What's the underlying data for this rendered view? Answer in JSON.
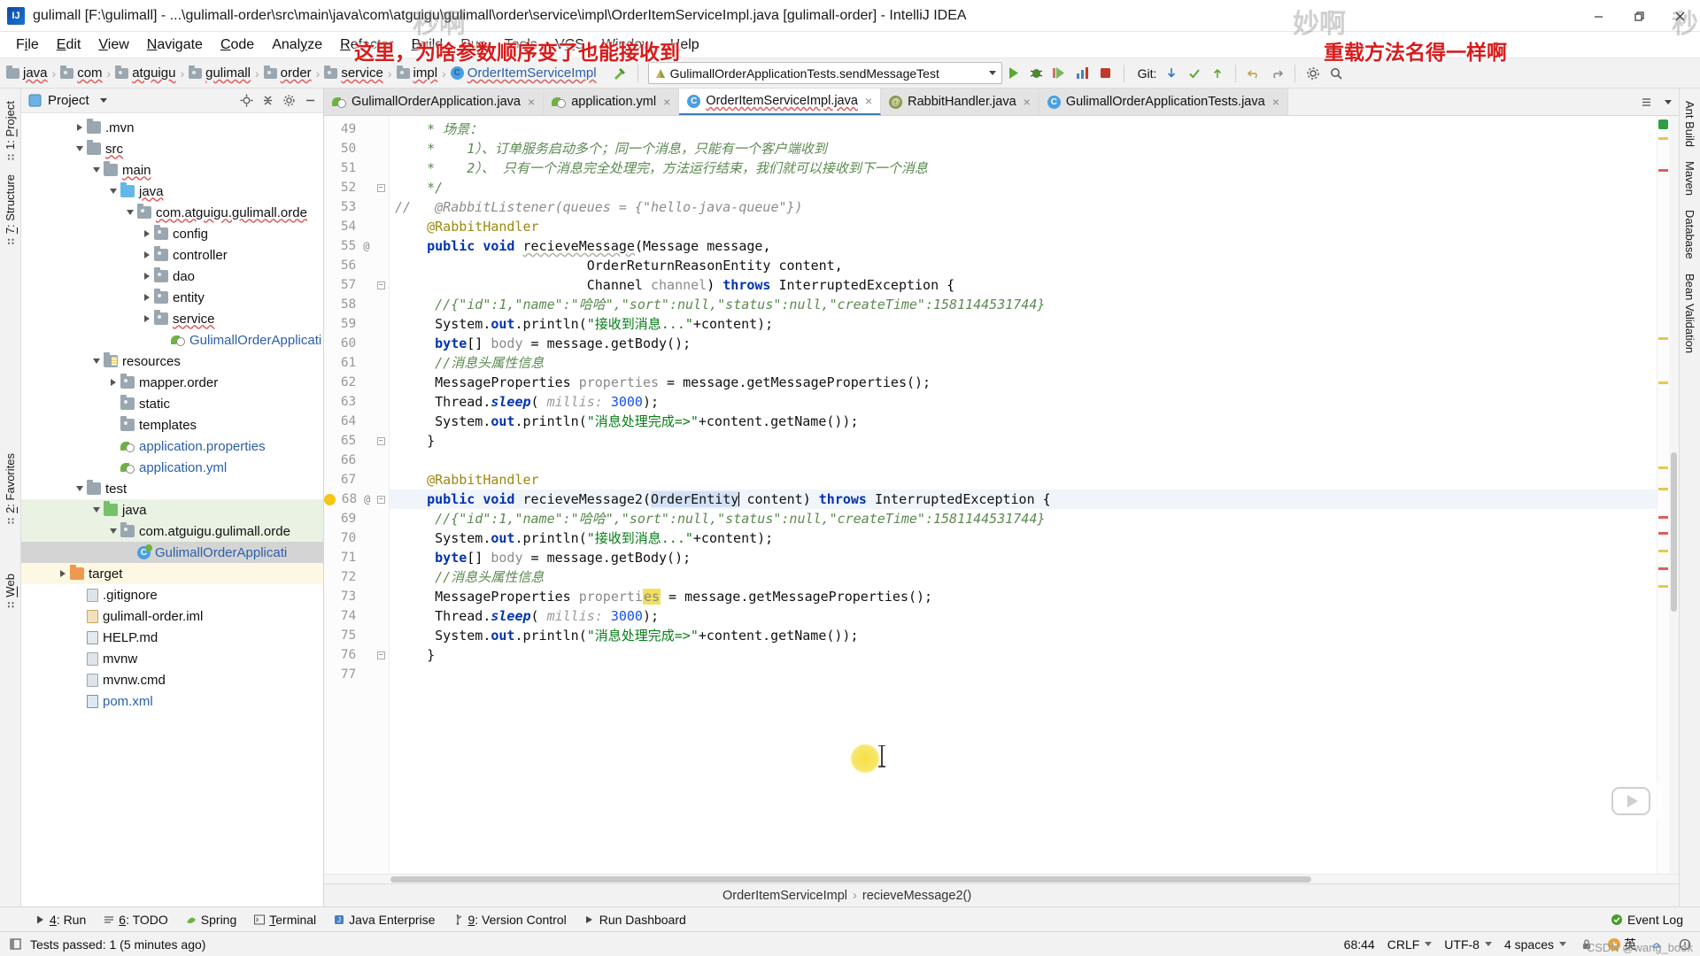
{
  "window": {
    "title": "gulimall [F:\\gulimall] - ...\\gulimall-order\\src\\main\\java\\com\\atguigu\\gulimall\\order\\service\\impl\\OrderItemServiceImpl.java [gulimall-order] - IntelliJ IDEA",
    "logo_text": "IJ",
    "minimize_label": "minimize-icon",
    "maximize_label": "restore-icon",
    "close_label": "close-icon"
  },
  "menubar": [
    {
      "pre": "F",
      "mn": "i",
      "post": "le"
    },
    {
      "pre": "",
      "mn": "E",
      "post": "dit"
    },
    {
      "pre": "",
      "mn": "V",
      "post": "iew"
    },
    {
      "pre": "",
      "mn": "N",
      "post": "avigate"
    },
    {
      "pre": "",
      "mn": "C",
      "post": "ode"
    },
    {
      "pre": "Anal",
      "mn": "y",
      "post": "ze"
    },
    {
      "pre": "",
      "mn": "R",
      "post": "efactor"
    },
    {
      "pre": "",
      "mn": "B",
      "post": "uild"
    },
    {
      "pre": "R",
      "mn": "u",
      "post": "n"
    },
    {
      "pre": "",
      "mn": "T",
      "post": "ools"
    },
    {
      "pre": "V",
      "mn": "C",
      "post": "S"
    },
    {
      "pre": "",
      "mn": "W",
      "post": "indow"
    },
    {
      "pre": "",
      "mn": "H",
      "post": "elp"
    }
  ],
  "breadcrumb": {
    "items": [
      {
        "label": "java",
        "icon": "folder-icon",
        "type": "folder"
      },
      {
        "label": "com",
        "icon": "package-icon",
        "type": "package"
      },
      {
        "label": "atguigu",
        "icon": "package-icon",
        "type": "package"
      },
      {
        "label": "gulimall",
        "icon": "package-icon",
        "type": "package"
      },
      {
        "label": "order",
        "icon": "package-icon",
        "type": "package"
      },
      {
        "label": "service",
        "icon": "package-icon",
        "type": "package"
      },
      {
        "label": "impl",
        "icon": "package-icon",
        "type": "package"
      },
      {
        "label": "OrderItemServiceImpl",
        "icon": "class-icon",
        "type": "class"
      }
    ],
    "separator": "›"
  },
  "toolbar": {
    "run_config": "GulimallOrderApplicationTests.sendMessageTest",
    "git_label": "Git:",
    "icons": [
      "hammer-build-icon",
      "run-icon",
      "debug-icon",
      "run-coverage-icon",
      "profiler-icon",
      "stop-icon",
      "update-project-icon",
      "commit-icon",
      "push-icon",
      "undo-icon",
      "redo-icon",
      "settings-icon",
      "search-everywhere-icon"
    ]
  },
  "project_panel": {
    "title": "Project",
    "header_icons": [
      "locate-icon",
      "collapse-all-icon",
      "settings-gear-icon",
      "hide-icon"
    ],
    "tree": [
      {
        "depth": 3,
        "label": ".mvn",
        "icon": "folder-icon",
        "twisty": "right",
        "sel": ""
      },
      {
        "depth": 3,
        "label": "src",
        "icon": "folder-icon",
        "twisty": "down",
        "sel": "",
        "squiggle": true
      },
      {
        "depth": 4,
        "label": "main",
        "icon": "folder-icon",
        "twisty": "down",
        "sel": "",
        "squiggle": true
      },
      {
        "depth": 5,
        "label": "java",
        "icon": "folder-blue-icon",
        "twisty": "down",
        "sel": "",
        "squiggle": true
      },
      {
        "depth": 6,
        "label": "com.atguigu.gulimall.orde",
        "icon": "package-icon",
        "twisty": "down",
        "sel": "",
        "squiggle": true
      },
      {
        "depth": 7,
        "label": "config",
        "icon": "package-icon",
        "twisty": "right",
        "sel": ""
      },
      {
        "depth": 7,
        "label": "controller",
        "icon": "package-icon",
        "twisty": "right",
        "sel": ""
      },
      {
        "depth": 7,
        "label": "dao",
        "icon": "package-icon",
        "twisty": "right",
        "sel": ""
      },
      {
        "depth": 7,
        "label": "entity",
        "icon": "package-icon",
        "twisty": "right",
        "sel": ""
      },
      {
        "depth": 7,
        "label": "service",
        "icon": "package-icon",
        "twisty": "right",
        "sel": "",
        "squiggle": true
      },
      {
        "depth": 8,
        "label": "GulimallOrderApplicati",
        "icon": "spring-class-icon",
        "twisty": "",
        "sel": "",
        "blue": true
      },
      {
        "depth": 4,
        "label": "resources",
        "icon": "resources-folder-icon",
        "twisty": "down",
        "sel": ""
      },
      {
        "depth": 5,
        "label": "mapper.order",
        "icon": "package-icon",
        "twisty": "right",
        "sel": ""
      },
      {
        "depth": 5,
        "label": "static",
        "icon": "package-icon",
        "twisty": "",
        "sel": ""
      },
      {
        "depth": 5,
        "label": "templates",
        "icon": "package-icon",
        "twisty": "",
        "sel": ""
      },
      {
        "depth": 5,
        "label": "application.properties",
        "icon": "spring-config-icon",
        "twisty": "",
        "sel": "",
        "blue": true
      },
      {
        "depth": 5,
        "label": "application.yml",
        "icon": "spring-config-icon",
        "twisty": "",
        "sel": "",
        "blue": true
      },
      {
        "depth": 3,
        "label": "test",
        "icon": "folder-icon",
        "twisty": "down",
        "sel": ""
      },
      {
        "depth": 4,
        "label": "java",
        "icon": "folder-green-icon",
        "twisty": "down",
        "sel": "sel-green"
      },
      {
        "depth": 5,
        "label": "com.atguigu.gulimall.orde",
        "icon": "package-icon",
        "twisty": "down",
        "sel": "sel-green"
      },
      {
        "depth": 6,
        "label": "GulimallOrderApplicati",
        "icon": "runnable-class-icon",
        "twisty": "",
        "sel": "sel-grey",
        "blue": true
      },
      {
        "depth": 2,
        "label": "target",
        "icon": "folder-orange-icon",
        "twisty": "right",
        "sel": "sel-yellow"
      },
      {
        "depth": 3,
        "label": ".gitignore",
        "icon": "file-icon",
        "twisty": "",
        "sel": ""
      },
      {
        "depth": 3,
        "label": "gulimall-order.iml",
        "icon": "iml-file-icon",
        "twisty": "",
        "sel": ""
      },
      {
        "depth": 3,
        "label": "HELP.md",
        "icon": "markdown-file-icon",
        "twisty": "",
        "sel": ""
      },
      {
        "depth": 3,
        "label": "mvnw",
        "icon": "file-icon",
        "twisty": "",
        "sel": ""
      },
      {
        "depth": 3,
        "label": "mvnw.cmd",
        "icon": "file-icon",
        "twisty": "",
        "sel": ""
      },
      {
        "depth": 3,
        "label": "pom.xml",
        "icon": "maven-pom-icon",
        "twisty": "",
        "sel": "",
        "blue": true
      }
    ]
  },
  "left_rail": [
    {
      "pre": "1: ",
      "mn": "P",
      "post": "roject",
      "name": "project-tool-tab"
    },
    {
      "pre": "",
      "mn": "7",
      "post": ": Structure",
      "name": "structure-tool-tab"
    },
    {
      "pre": "",
      "mn": "2",
      "post": ": Favorites",
      "name": "favorites-tool-tab"
    },
    {
      "pre": "",
      "mn": "W",
      "post": "eb",
      "name": "web-tool-tab"
    }
  ],
  "right_rail": [
    {
      "label": "Ant Build",
      "name": "ant-build-tool-tab"
    },
    {
      "label": "Maven",
      "name": "maven-tool-tab"
    },
    {
      "label": "Database",
      "name": "database-tool-tab"
    },
    {
      "label": "Bean Validation",
      "name": "bean-validation-tool-tab"
    }
  ],
  "editor_tabs": [
    {
      "label": "GulimallOrderApplication.java",
      "icon": "spring-class-icon",
      "active": false
    },
    {
      "label": "application.yml",
      "icon": "spring-config-icon",
      "active": false
    },
    {
      "label": "OrderItemServiceImpl.java",
      "icon": "class-icon",
      "active": true
    },
    {
      "label": "RabbitHandler.java",
      "icon": "annotation-icon",
      "active": false
    },
    {
      "label": "GulimallOrderApplicationTests.java",
      "icon": "test-class-icon",
      "active": false
    }
  ],
  "editor": {
    "first_line": 49,
    "lines": [
      {
        "n": 49,
        "mark": "",
        "fold": "",
        "html": "    <span class=\"cmtg\">* 场景：</span>"
      },
      {
        "n": 50,
        "mark": "",
        "fold": "",
        "html": "    <span class=\"cmtg\">*    <i>1</i>）、订单服务启动多个；同一个消息，只能有一个客户端收到</span>"
      },
      {
        "n": 51,
        "mark": "",
        "fold": "",
        "html": "    <span class=\"cmtg\">*    <i>2</i>）、 只有一个消息完全处理完，方法运行结束，我们就可以接收到下一个消息</span>"
      },
      {
        "n": 52,
        "mark": "",
        "fold": "box",
        "html": "    <span class=\"cmtg\">*/</span>"
      },
      {
        "n": 53,
        "mark": "",
        "fold": "",
        "html": "<span class=\"cmt\">//   @RabbitListener(queues = {\"hello-java-queue\"})</span>"
      },
      {
        "n": 54,
        "mark": "",
        "fold": "",
        "html": "    <span class=\"ann\">@RabbitHandler</span>"
      },
      {
        "n": 55,
        "mark": "@",
        "fold": "",
        "html": "    <span class=\"k\">public</span> <span class=\"k\">void</span> <span class=\"ident sqgreen\">recieveMessage</span>(<span class=\"cls\">Message</span> <span class=\"ident\">message</span>,"
      },
      {
        "n": 56,
        "mark": "",
        "fold": "",
        "html": "                        <span class=\"cls\">OrderReturnReasonEntity</span> <span class=\"ident\">content</span>,"
      },
      {
        "n": 57,
        "mark": "",
        "fold": "box",
        "html": "                        <span class=\"cls\">Channel</span> <span class=\"fld\">channel</span>) <span class=\"k\">throws</span> <span class=\"cls\">InterruptedException</span> {"
      },
      {
        "n": 58,
        "mark": "",
        "fold": "",
        "html": "     <span class=\"cmtg\">//{\"id\":1,\"name\":\"哈哈\",\"sort\":null,\"status\":null,\"createTime\":1581144531744}</span>"
      },
      {
        "n": 59,
        "mark": "",
        "fold": "",
        "html": "     <span class=\"ident\">System.</span><span class=\"k\">out</span><span class=\"ident\">.println(</span><span class=\"str\">\"接收到消息...\"</span><span class=\"ident\">+content);</span>"
      },
      {
        "n": 60,
        "mark": "",
        "fold": "",
        "html": "     <span class=\"k\">byte</span>[] <span class=\"fld\">body</span> = <span class=\"ident\">message.getBody();</span>"
      },
      {
        "n": 61,
        "mark": "",
        "fold": "",
        "html": "     <span class=\"cmtg\">//消息头属性信息</span>"
      },
      {
        "n": 62,
        "mark": "",
        "fold": "",
        "html": "     <span class=\"cls\">MessageProperties</span> <span class=\"fld\">properties</span> = <span class=\"ident\">message.getMessageProperties();</span>"
      },
      {
        "n": 63,
        "mark": "",
        "fold": "",
        "html": "     <span class=\"cls\">Thread.</span><span class=\"k\"><i>sleep</i></span><span class=\"ident\">(</span> <span class=\"hintp\">millis:</span> <span class=\"num\">3000</span><span class=\"ident\">);</span>"
      },
      {
        "n": 64,
        "mark": "",
        "fold": "",
        "html": "     <span class=\"ident\">System.</span><span class=\"k\">out</span><span class=\"ident\">.println(</span><span class=\"str\">\"消息处理完成=&gt;\"</span><span class=\"ident\">+content.getName());</span>"
      },
      {
        "n": 65,
        "mark": "",
        "fold": "box",
        "html": "    <span class=\"ident\">}</span>"
      },
      {
        "n": 66,
        "mark": "",
        "fold": "",
        "html": ""
      },
      {
        "n": 67,
        "mark": "",
        "fold": "",
        "html": "    <span class=\"ann\">@RabbitHandler</span>"
      },
      {
        "n": 68,
        "mark": "@",
        "fold": "box",
        "bulb": true,
        "hl": true,
        "html": "    <span class=\"k\">public</span> <span class=\"k\">void</span> <span class=\"ident\">recieveMessage2</span>(<span class=\"cls selbox\">OrderEntity</span><span class=\"caret\"></span> <span class=\"ident\">content</span>) <span class=\"k\">throws</span> <span class=\"cls\">InterruptedException</span> {"
      },
      {
        "n": 69,
        "mark": "",
        "fold": "",
        "html": "     <span class=\"cmtg\">//{\"id\":1,\"name\":\"哈哈\",\"sort\":null,\"status\":null,\"createTime\":1581144531744}</span>"
      },
      {
        "n": 70,
        "mark": "",
        "fold": "",
        "html": "     <span class=\"ident\">System.</span><span class=\"k\">out</span><span class=\"ident\">.println(</span><span class=\"str\">\"接收到消息...\"</span><span class=\"ident\">+content);</span>"
      },
      {
        "n": 71,
        "mark": "",
        "fold": "",
        "html": "     <span class=\"k\">byte</span>[] <span class=\"fld\">body</span> = <span class=\"ident\">message.getBody();</span>"
      },
      {
        "n": 72,
        "mark": "",
        "fold": "",
        "html": "     <span class=\"cmtg\">//消息头属性信息</span>"
      },
      {
        "n": 73,
        "mark": "",
        "fold": "",
        "html": "     <span class=\"cls\">MessageProperties</span> <span class=\"fld\">properti<span class=\"mouse-hl\">es</span></span> = <span class=\"ident\">message.getMessageProperties();</span>"
      },
      {
        "n": 74,
        "mark": "",
        "fold": "",
        "html": "     <span class=\"cls\">Thread.</span><span class=\"k\"><i>sleep</i></span><span class=\"ident\">(</span> <span class=\"hintp\">millis:</span> <span class=\"num\">3000</span><span class=\"ident\">);</span>"
      },
      {
        "n": 75,
        "mark": "",
        "fold": "",
        "html": "     <span class=\"ident\">System.</span><span class=\"k\">out</span><span class=\"ident\">.println(</span><span class=\"str\">\"消息处理完成=&gt;\"</span><span class=\"ident\">+content.getName());</span>"
      },
      {
        "n": 76,
        "mark": "",
        "fold": "box",
        "html": "    <span class=\"ident\">}</span>"
      },
      {
        "n": 77,
        "mark": "",
        "fold": "",
        "html": ""
      }
    ],
    "bottom_breadcrumb": [
      "OrderItemServiceImpl",
      "recieveMessage2()"
    ],
    "bottom_breadcrumb_sep": "›"
  },
  "bottom_toolwindows": [
    {
      "pre": "",
      "mn": "4",
      "post": ": Run",
      "icon": "run-icon",
      "name": "run-tool-window"
    },
    {
      "pre": "",
      "mn": "6",
      "post": ": TODO",
      "icon": "todo-icon",
      "name": "todo-tool-window"
    },
    {
      "pre": "Spring",
      "mn": "",
      "post": "",
      "icon": "spring-icon",
      "name": "spring-tool-window"
    },
    {
      "pre": "",
      "mn": "T",
      "post": "erminal",
      "icon": "terminal-icon",
      "name": "terminal-tool-window"
    },
    {
      "pre": "Java Enterprise",
      "mn": "",
      "post": "",
      "icon": "java-ee-icon",
      "name": "java-enterprise-tool-window"
    },
    {
      "pre": "",
      "mn": "9",
      "post": ": Version Control",
      "icon": "vcs-icon",
      "name": "version-control-tool-window"
    },
    {
      "pre": "Run Dashboard",
      "mn": "",
      "post": "",
      "icon": "dashboard-icon",
      "name": "run-dashboard-tool-window"
    }
  ],
  "event_log": {
    "label": "Event Log",
    "icon": "event-log-icon"
  },
  "statusbar": {
    "message": "Tests passed: 1 (5 minutes ago)",
    "caret_position": "68:44",
    "line_separator": "CRLF",
    "encoding": "UTF-8",
    "indent": "4 spaces",
    "ime_lang": "英",
    "icons": [
      "show-toolwindows-icon",
      "lock-icon",
      "ime-icon",
      "notifications-icon",
      "inspection-icon"
    ]
  },
  "overlays": {
    "watermark_left": "秒啊",
    "watermark_right": "妙啊",
    "watermark_corner": "秒",
    "annotation_center": "这里，为啥参数顺序变了也能接收到",
    "annotation_right": "重载方法名得一样啊",
    "csdn_credit": "CSDN @wang_book"
  }
}
